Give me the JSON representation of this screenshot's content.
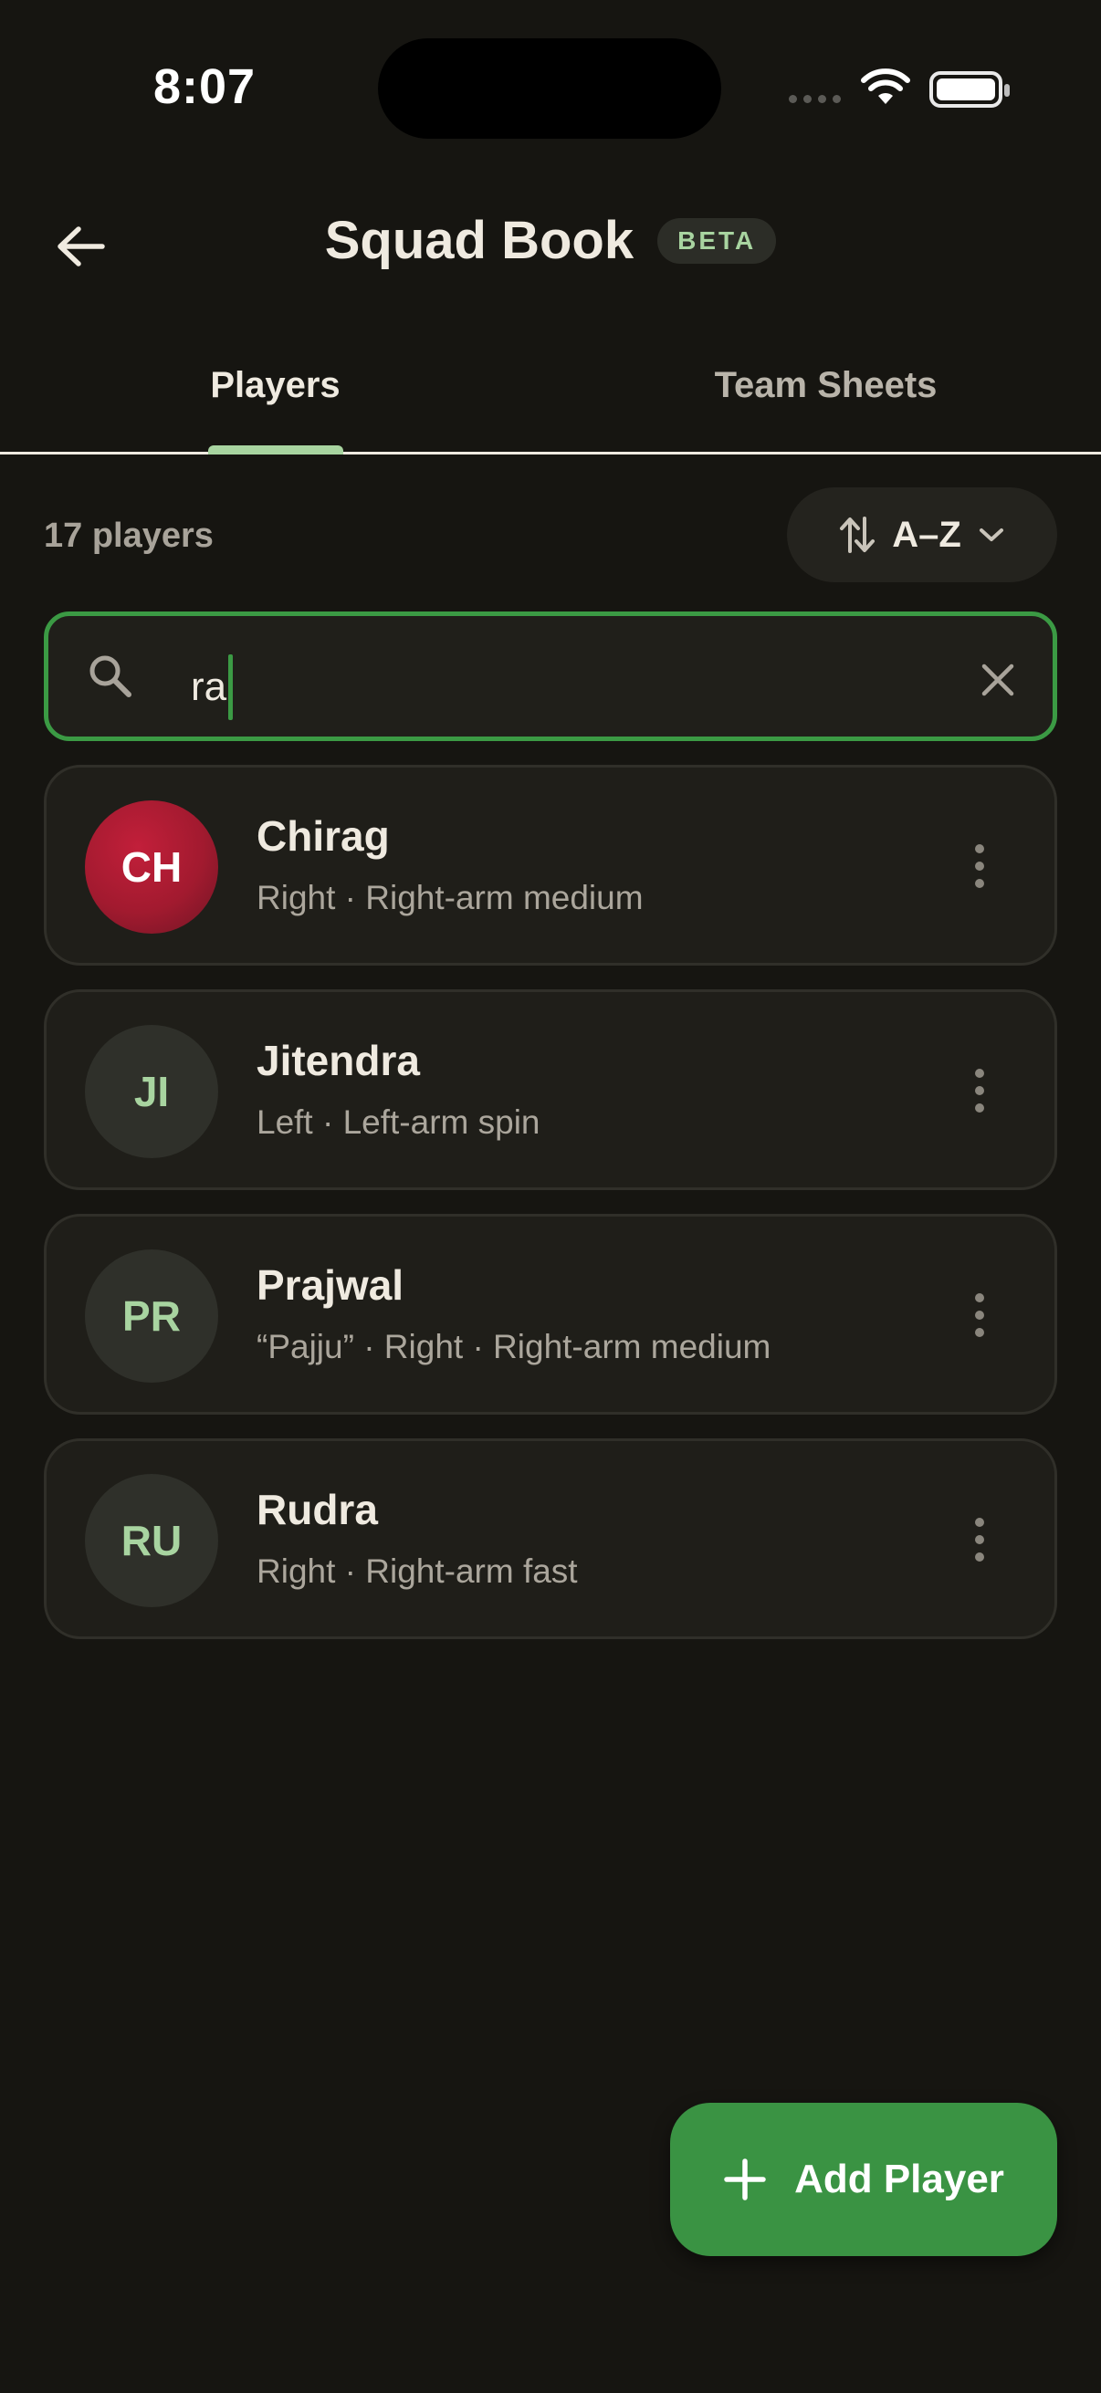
{
  "status_bar": {
    "time": "8:07"
  },
  "header": {
    "title": "Squad Book",
    "badge": "BETA"
  },
  "tabs": [
    {
      "label": "Players",
      "active": true
    },
    {
      "label": "Team Sheets",
      "active": false
    }
  ],
  "toolbar": {
    "count": "17 players",
    "sort_label": "A–Z"
  },
  "search": {
    "value": "ra"
  },
  "players": [
    {
      "initials": "CH",
      "name": "Chirag",
      "details": "Right · Right-arm medium"
    },
    {
      "initials": "JI",
      "name": "Jitendra",
      "details": "Left · Left-arm spin"
    },
    {
      "initials": "PR",
      "name": "Prajwal",
      "details": "“Pajju” · Right · Right-arm medium"
    },
    {
      "initials": "RU",
      "name": "Rudra",
      "details": "Right · Right-arm fast"
    }
  ],
  "fab": {
    "label": "Add Player"
  },
  "colors": {
    "background": "#161511",
    "accent": "#3a9343",
    "accent_light": "#a8d4a0",
    "highlight_avatar": "#a21a2f"
  }
}
